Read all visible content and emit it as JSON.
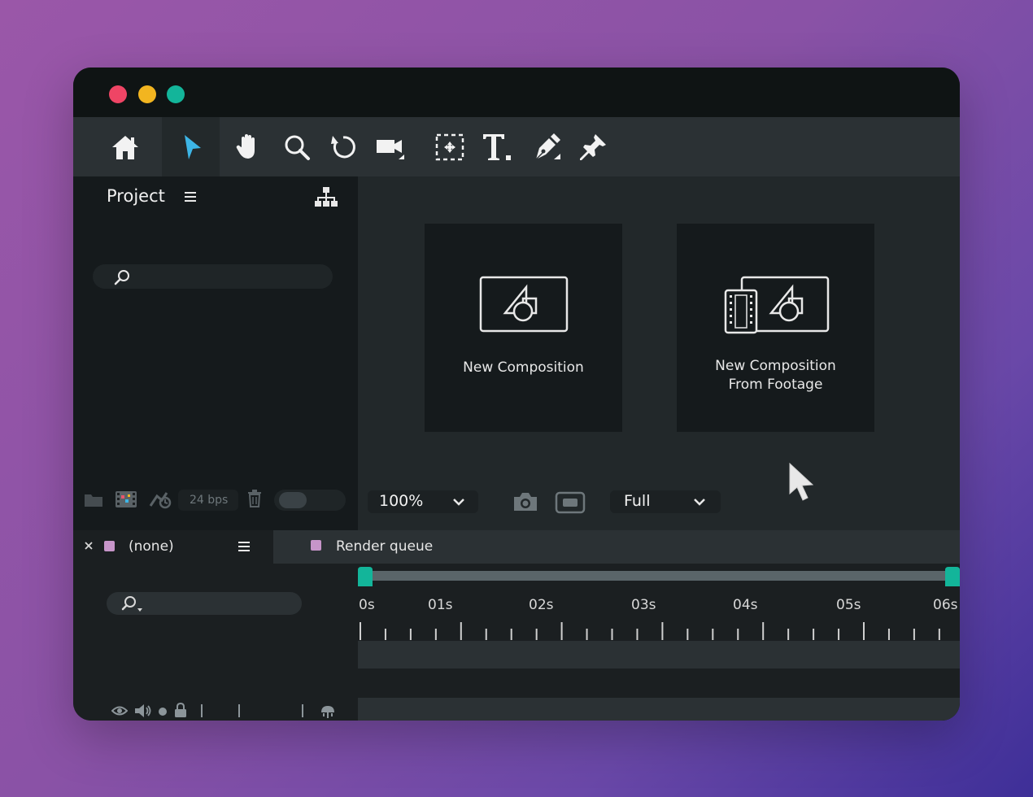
{
  "window": {
    "controls": [
      {
        "name": "close-dot",
        "color": "#ef4565"
      },
      {
        "name": "minimize-dot",
        "color": "#f2b520"
      },
      {
        "name": "zoom-dot",
        "color": "#13b59a"
      }
    ]
  },
  "toolbar": {
    "tools": [
      {
        "name": "home-tool",
        "icon": "home-icon"
      },
      {
        "name": "selection-tool",
        "icon": "pointer-arrow-icon",
        "active": true
      },
      {
        "name": "hand-tool",
        "icon": "hand-icon"
      },
      {
        "name": "zoom-tool",
        "icon": "magnifier-icon"
      },
      {
        "name": "rotate-tool",
        "icon": "rotate-icon"
      },
      {
        "name": "camera-tool",
        "icon": "video-camera-icon"
      },
      {
        "name": "pan-behind-tool",
        "icon": "anchor-box-icon"
      },
      {
        "name": "type-tool",
        "icon": "type-t-icon"
      },
      {
        "name": "pen-tool",
        "icon": "pen-nib-icon"
      },
      {
        "name": "puppet-pin-tool",
        "icon": "pin-icon"
      }
    ],
    "accent_color": "#3db5e6"
  },
  "project": {
    "title": "Project",
    "search_placeholder": "",
    "footer": {
      "bpc_label": "24 bps"
    }
  },
  "viewer": {
    "cards": [
      {
        "label": "New Composition"
      },
      {
        "label_line1": "New Composition",
        "label_line2": "From Footage"
      }
    ],
    "zoom": "100%",
    "resolution": "Full"
  },
  "timeline": {
    "tabs": [
      {
        "label": "(none)",
        "swatch": "#c795c9"
      },
      {
        "label": "Render queue",
        "swatch": "#c795c9"
      }
    ],
    "ruler": [
      "0s",
      "01s",
      "02s",
      "03s",
      "04s",
      "05s",
      "06s"
    ],
    "range_color": "#13b59a"
  }
}
